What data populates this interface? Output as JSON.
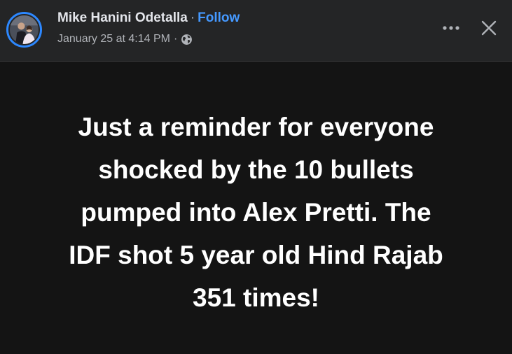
{
  "post": {
    "author": "Mike Hanini Odetalla",
    "separator_dot": "·",
    "follow_label": "Follow",
    "timestamp": "January 25 at 4:14 PM",
    "meta_separator": "·",
    "audience_icon": "globe-icon",
    "text": "Just a reminder for everyone\nshocked by the 10 bullets\npumped into Alex Pretti. The\nIDF shot 5 year old Hind Rajab\n351 times!"
  },
  "header": {
    "more_icon": "more-options-icon",
    "close_icon": "close-icon"
  },
  "colors": {
    "header_bg": "#242526",
    "body_bg": "#141414",
    "link": "#4599ff",
    "secondary_text": "#b0b3b8",
    "avatar_ring": "#2d88ff"
  }
}
